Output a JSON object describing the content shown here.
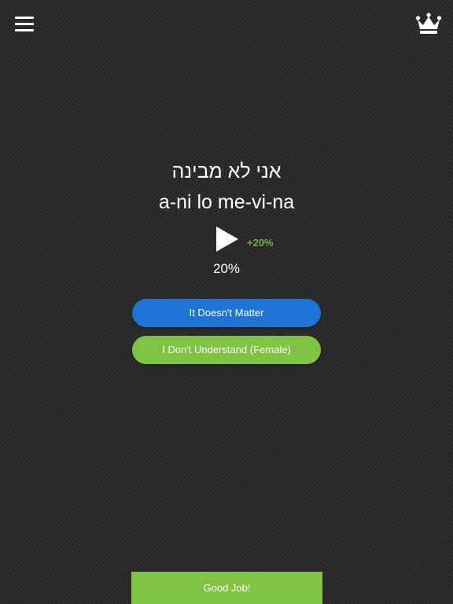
{
  "header": {
    "menu_icon": "hamburger-menu-icon",
    "premium_icon": "crown-icon"
  },
  "phrase": {
    "hebrew": "אני לא מבינה",
    "transliteration": "a-ni lo me-vi-na",
    "play_icon": "play-icon",
    "bonus": "+20%",
    "progress": "20%"
  },
  "answers": [
    {
      "label": "It Doesn't Matter",
      "color": "#1e74d3"
    },
    {
      "label": "I Don't Understand (Female)",
      "color": "#80c342"
    }
  ],
  "footer": {
    "feedback_label": "Good Job!",
    "color": "#80c342"
  },
  "colors": {
    "bonus_text": "#6db33f",
    "text": "#ffffff"
  }
}
